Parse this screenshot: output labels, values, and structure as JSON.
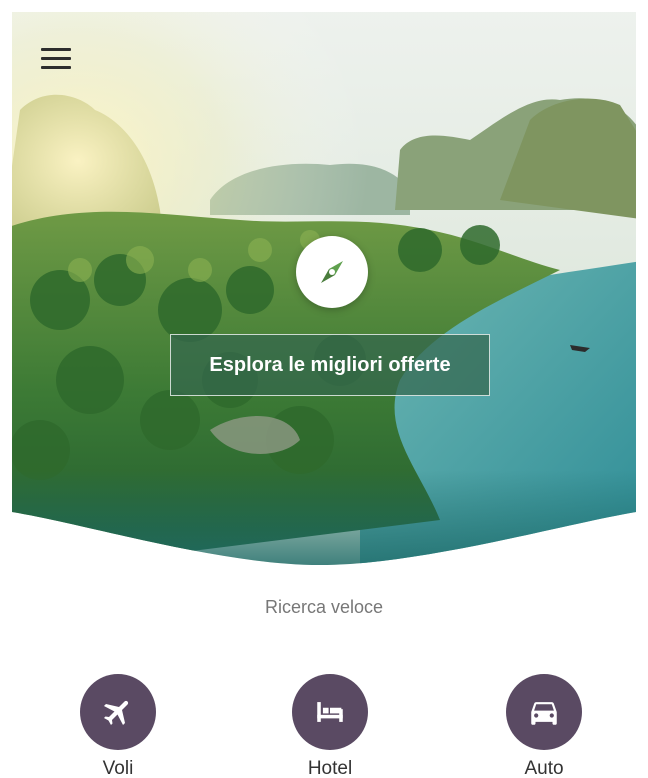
{
  "header": {
    "menu_icon": "hamburger-menu-icon"
  },
  "hero": {
    "explore_icon": "compass-icon",
    "cta_label": "Esplora le migliori offerte",
    "colors": {
      "overlay": "#34664e",
      "wave": "#1f6c6a"
    }
  },
  "quick_search": {
    "title": "Ricerca veloce",
    "accent": "#5a4a63",
    "items": [
      {
        "label": "Voli",
        "icon": "airplane-icon"
      },
      {
        "label": "Hotel",
        "icon": "bed-icon"
      },
      {
        "label": "Auto",
        "icon": "car-icon"
      }
    ]
  }
}
